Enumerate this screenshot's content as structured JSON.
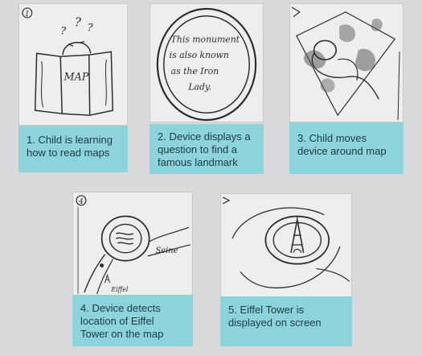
{
  "panels": [
    {
      "number": "1",
      "caption_lines": [
        "1. Child is learning",
        "how to read maps"
      ],
      "sketch_text": [
        "MAP"
      ],
      "sketch_marks": [
        "?",
        "?",
        "?"
      ]
    },
    {
      "number": "2",
      "caption_lines": [
        "2. Device displays a",
        "question to find a",
        "famous landmark"
      ],
      "sketch_text": [
        "This monument",
        "is also known",
        "as the Iron",
        "Lady."
      ]
    },
    {
      "number": "3",
      "caption_lines": [
        "3. Child moves",
        "device around map"
      ],
      "sketch_text": []
    },
    {
      "number": "4",
      "caption_lines": [
        "4. Device detects",
        "location of Eiffel",
        "Tower on the map"
      ],
      "sketch_text": [
        "Seine",
        "Eiffel"
      ]
    },
    {
      "number": "5",
      "caption_lines": [
        "5. Eiffel Tower is",
        "displayed on screen"
      ],
      "sketch_text": []
    }
  ],
  "colors": {
    "background": "#d9dadb",
    "caption_bg": "#8cd3dc",
    "sketch_paper": "#eeeeec",
    "pencil": "#2b2b2b"
  }
}
